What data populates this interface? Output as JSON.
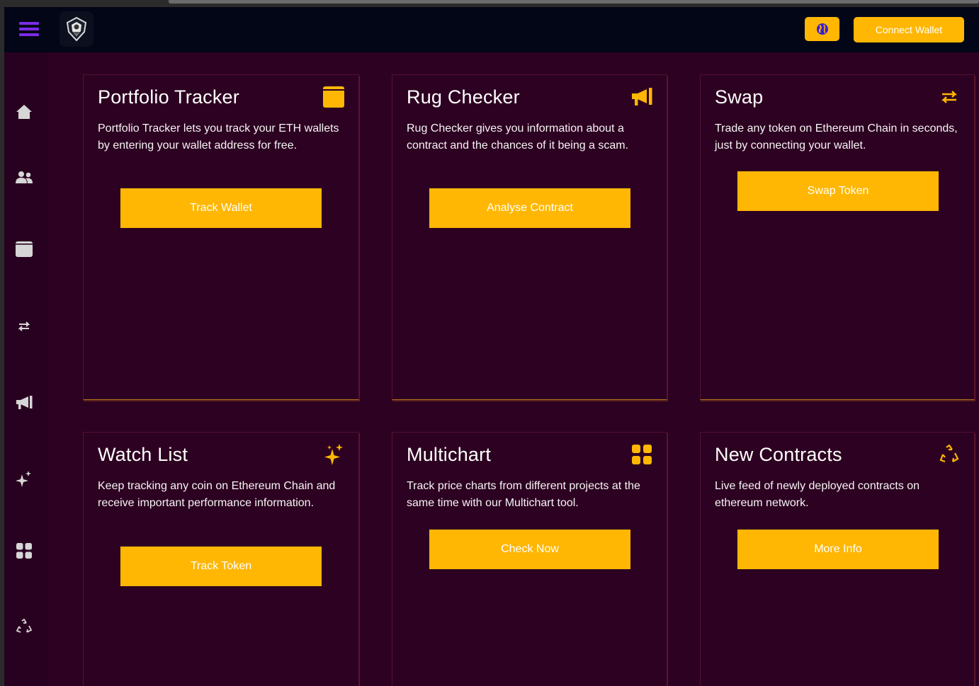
{
  "header": {
    "connect_label": "Connect Wallet"
  },
  "colors": {
    "accent": "#ffb703",
    "background": "#2d0121",
    "header": "#020617",
    "menu": "#7c2ae8"
  },
  "sidebar": {
    "items": [
      {
        "icon": "home-icon"
      },
      {
        "icon": "users-icon"
      },
      {
        "icon": "wallet-icon"
      },
      {
        "icon": "swap-icon"
      },
      {
        "icon": "megaphone-icon"
      },
      {
        "icon": "sparkles-icon"
      },
      {
        "icon": "grid-icon"
      },
      {
        "icon": "recycle-icon"
      }
    ]
  },
  "cards": [
    {
      "title": "Portfolio Tracker",
      "icon": "wallet-icon",
      "description": "Portfolio Tracker lets you track your ETH wallets by entering your wallet address for free.",
      "button": "Track Wallet"
    },
    {
      "title": "Rug Checker",
      "icon": "megaphone-icon",
      "description": "Rug Checker gives you information about a contract and the chances of it being a scam.",
      "button": "Analyse Contract"
    },
    {
      "title": "Swap",
      "icon": "swap-icon",
      "description": "Trade any token on Ethereum Chain in seconds, just by connecting your wallet.",
      "button": "Swap Token"
    },
    {
      "title": "Watch List",
      "icon": "sparkles-icon",
      "description": "Keep tracking any coin on Ethereum Chain and receive important performance information.",
      "button": "Track Token"
    },
    {
      "title": "Multichart",
      "icon": "grid-icon",
      "description": "Track price charts from different projects at the same time with our Multichart tool.",
      "button": "Check Now"
    },
    {
      "title": "New Contracts",
      "icon": "recycle-icon",
      "description": "Live feed of newly deployed contracts on ethereum network.",
      "button": "More Info"
    }
  ]
}
